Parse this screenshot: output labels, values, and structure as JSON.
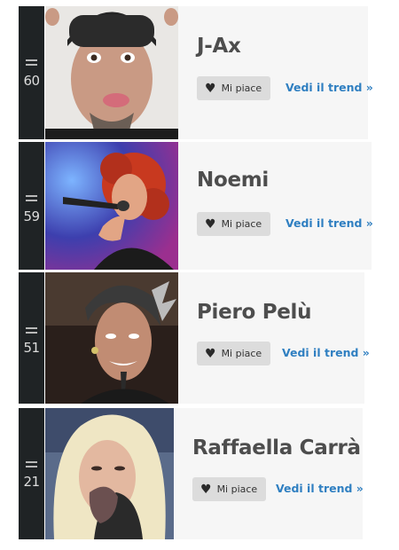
{
  "artists": [
    {
      "rank": "60",
      "name": "J-Ax",
      "like_label": "Mi piace",
      "trend_label": "Vedi il trend »",
      "photo_icon": "artist-photo"
    },
    {
      "rank": "59",
      "name": "Noemi",
      "like_label": "Mi piace",
      "trend_label": "Vedi il trend »",
      "photo_icon": "artist-photo"
    },
    {
      "rank": "51",
      "name": "Piero Pelù",
      "like_label": "Mi piace",
      "trend_label": "Vedi il trend »",
      "photo_icon": "artist-photo"
    },
    {
      "rank": "21",
      "name": "Raffaella Carrà",
      "like_label": "Mi piace",
      "trend_label": "Vedi il trend »",
      "photo_icon": "artist-photo"
    }
  ],
  "colors": {
    "rank_bg": "#1f2325",
    "panel_bg": "#f6f6f6",
    "like_bg": "#dcdcdc",
    "link": "#2f7fc1",
    "name": "#4d4d4d"
  },
  "icons": {
    "trend_status": "equals-icon",
    "like": "heart-icon"
  }
}
